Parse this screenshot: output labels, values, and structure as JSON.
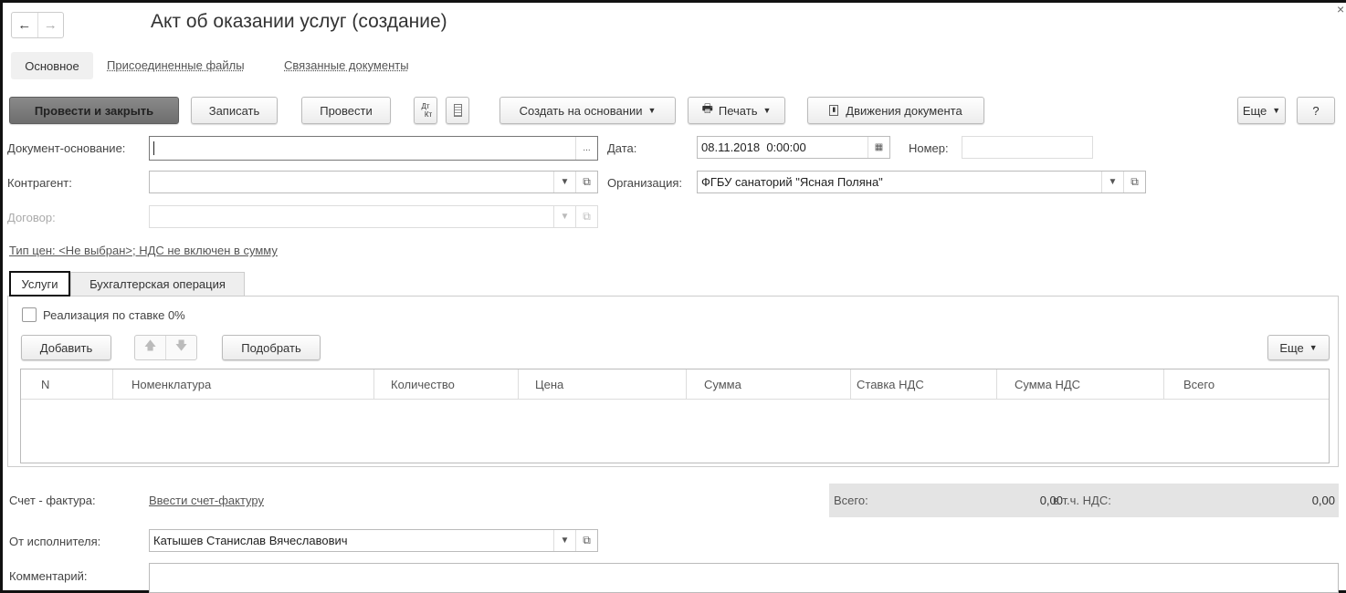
{
  "window": {
    "title": "Акт об оказании услуг (создание)",
    "close": "×"
  },
  "nav": {
    "back": "←",
    "forward": "→"
  },
  "section_tabs": [
    "Основное",
    "Присоединенные файлы",
    "Связанные документы"
  ],
  "toolbar": {
    "post_close": "Провести и закрыть",
    "save": "Записать",
    "post": "Провести",
    "dtkt_top": "Дт",
    "dtkt_bottom": "Кт",
    "create_based": "Создать на основании",
    "print": "Печать",
    "movements": "Движения документа",
    "more": "Еще",
    "help": "?"
  },
  "form": {
    "base_doc_label": "Документ-основание:",
    "base_doc_value": "",
    "ellipsis": "...",
    "date_label": "Дата:",
    "date_value": "08.11.2018  0:00:00",
    "number_label": "Номер:",
    "number_value": "",
    "counterparty_label": "Контрагент:",
    "counterparty_value": "",
    "org_label": "Организация:",
    "org_value": "ФГБУ санаторий \"Ясная Поляна\"",
    "contract_label": "Договор:",
    "contract_value": "",
    "price_link": "Тип цен: <Не выбран>; НДС не включен в сумму"
  },
  "inner_tabs": [
    "Услуги",
    "Бухгалтерская операция"
  ],
  "services": {
    "zero_rate_label": "Реализация по ставке 0%",
    "zero_rate_checked": false,
    "add": "Добавить",
    "pick": "Подобрать",
    "more": "Еще",
    "columns": [
      "N",
      "Номенклатура",
      "Количество",
      "Цена",
      "Сумма",
      "Ставка НДС",
      "Сумма НДС",
      "Всего"
    ],
    "rows": []
  },
  "footer": {
    "invoice_label": "Счет - фактура:",
    "invoice_link": "Ввести счет-фактуру",
    "total_label": "Всего:",
    "total_value": "0,00",
    "vat_label": "в т.ч. НДС:",
    "vat_value": "0,00",
    "performer_label": "От исполнителя:",
    "performer_value": "Катышев Станислав Вячеславович",
    "comment_label": "Комментарий:",
    "comment_value": ""
  }
}
